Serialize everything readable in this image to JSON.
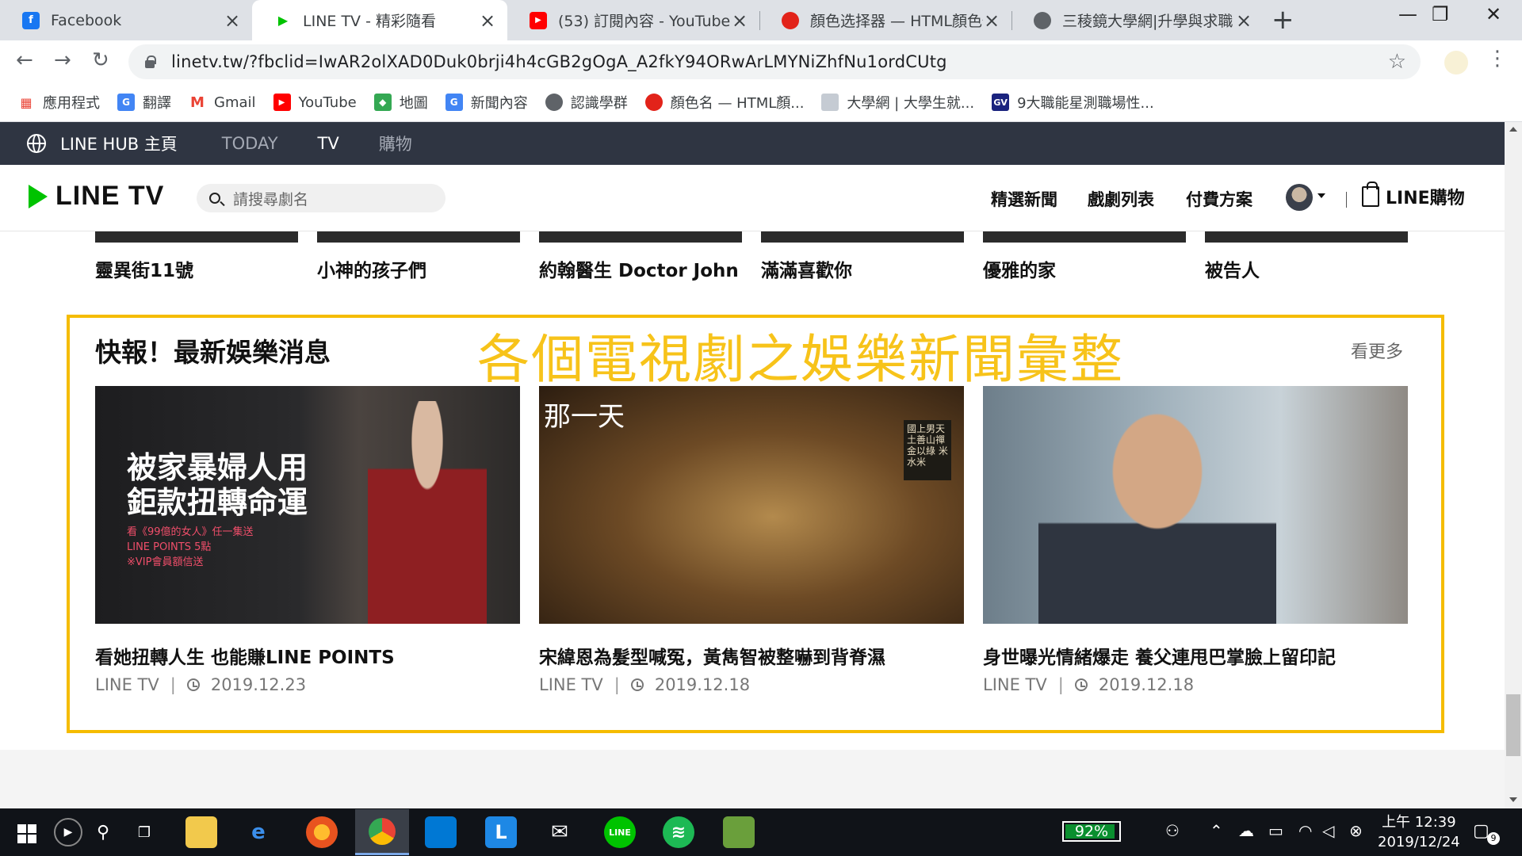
{
  "browser": {
    "tabs": [
      {
        "title": "Facebook",
        "color": "#1877f2",
        "glyph": "f"
      },
      {
        "title": "LINE TV - 精彩隨看",
        "color": "#00c300",
        "glyph": "▶"
      },
      {
        "title": "(53) 訂閱內容 - YouTube",
        "color": "#ff0000",
        "glyph": "▶"
      },
      {
        "title": "顏色选择器 — HTML顏色代",
        "color": "#e2231a",
        "glyph": "●"
      },
      {
        "title": "三稜鏡大學網|升學與求職",
        "color": "#5f6368",
        "glyph": "●"
      }
    ],
    "new_tab": "+",
    "window_controls": {
      "minimize": "—",
      "restore": "❐",
      "close": "✕"
    },
    "url": "linetv.tw/?fbclid=IwAR2olXAD0Duk0brji4h4cGB2gOgA_A2fkY94ORwArLMYNiZhfNu1ordCUtg",
    "bookmarks": [
      {
        "label": "應用程式",
        "color": "#ea4335",
        "glyph": "⋮"
      },
      {
        "label": "翻譯",
        "color": "#4285f4",
        "glyph": "G"
      },
      {
        "label": "Gmail",
        "color": "#ea4335",
        "glyph": "M"
      },
      {
        "label": "YouTube",
        "color": "#ff0000",
        "glyph": "▶"
      },
      {
        "label": "地圖",
        "color": "#34a853",
        "glyph": "◆"
      },
      {
        "label": "新聞內容",
        "color": "#4285f4",
        "glyph": "G"
      },
      {
        "label": "認識學群",
        "color": "#5f6368",
        "glyph": "●"
      },
      {
        "label": "顏色名 — HTML顏...",
        "color": "#e2231a",
        "glyph": "●"
      },
      {
        "label": "大學網 | 大學生就...",
        "color": "#9aa0a6",
        "glyph": "▮"
      },
      {
        "label": "9大職能星測職場性...",
        "color": "#1a237e",
        "glyph": "GV"
      }
    ]
  },
  "hub": {
    "home": "LINE HUB 主頁",
    "items": [
      "TODAY",
      "TV",
      "購物"
    ]
  },
  "header": {
    "logo": "LINE TV",
    "search_placeholder": "請搜尋劇名",
    "nav": [
      "精選新聞",
      "戲劇列表",
      "付費方案"
    ],
    "shop": "LINE購物"
  },
  "dramas": [
    "靈異街11號",
    "小神的孩子們",
    "約翰醫生 Doctor John",
    "滿滿喜歡你",
    "優雅的家",
    "被告人"
  ],
  "news": {
    "heading": "快報！最新娛樂消息",
    "overlay_title": "各個電視劇之娛樂新聞彙整",
    "more": "看更多",
    "promo": {
      "line1": "被家暴婦人用",
      "line2": "鉅款扭轉命運",
      "small1": "看《99億的女人》任一集送",
      "small2": "LINE POINTS 5點",
      "small3": "※VIP會員額信送"
    },
    "img2_title": "那一天",
    "img2_sign": "國上男天 土善山禪 金以綠 米水米",
    "cards": [
      {
        "title": "看她扭轉人生 也能賺LINE POINTS",
        "source": "LINE TV",
        "date": "2019.12.23"
      },
      {
        "title": "宋緯恩為髮型喊冤，黃雋智被整嚇到背脊濕",
        "source": "LINE TV",
        "date": "2019.12.18"
      },
      {
        "title": "身世曝光情緒爆走 養父連甩巴掌臉上留印記",
        "source": "LINE TV",
        "date": "2019.12.18"
      }
    ]
  },
  "taskbar": {
    "battery": "92%",
    "time": "上午 12:39",
    "date": "2019/12/24",
    "notifications": "9"
  }
}
